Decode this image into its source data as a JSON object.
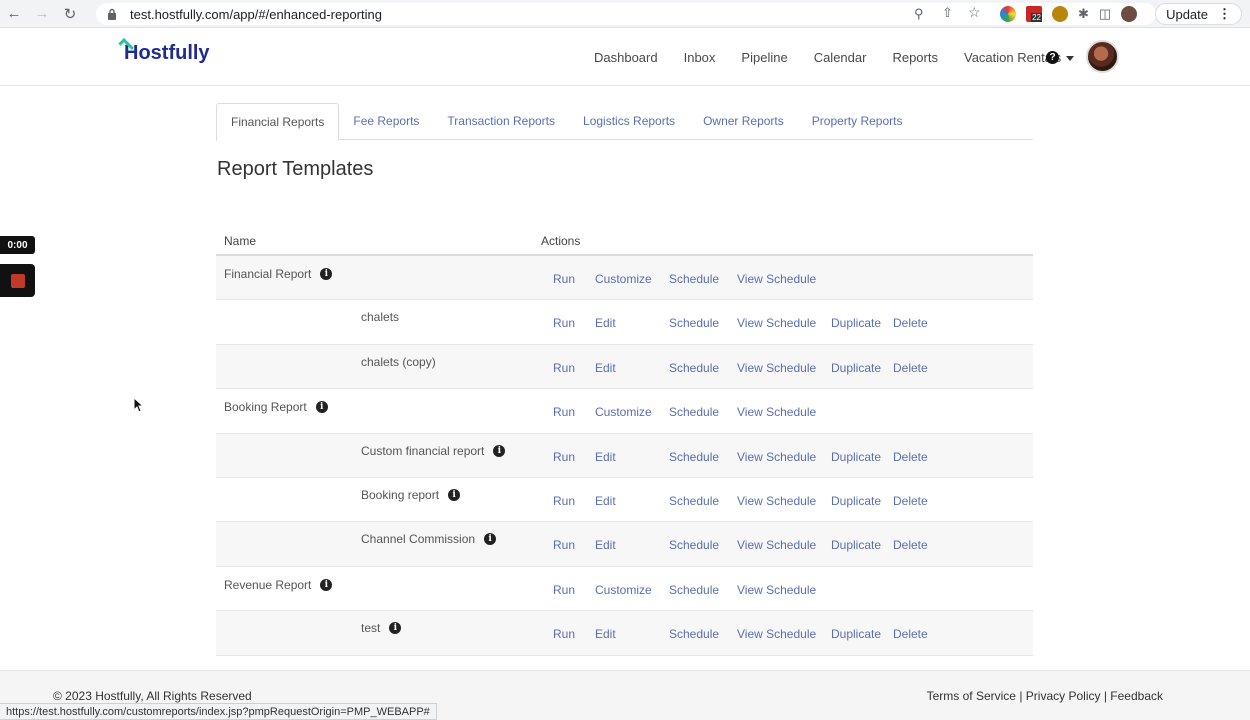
{
  "browser": {
    "url": "test.hostfully.com/app/#/enhanced-reporting",
    "update_label": "Update",
    "status_url": "https://test.hostfully.com/customreports/index.jsp?pmpRequestOrigin=PMP_WEBAPP#",
    "ext_badge": "22"
  },
  "header": {
    "logo_text": "Hostfully",
    "nav": [
      "Dashboard",
      "Inbox",
      "Pipeline",
      "Calendar",
      "Reports",
      "Vacation Rentals"
    ],
    "help_glyph": "?"
  },
  "tabs": [
    {
      "label": "Financial Reports",
      "active": true
    },
    {
      "label": "Fee Reports",
      "active": false
    },
    {
      "label": "Transaction Reports",
      "active": false
    },
    {
      "label": "Logistics Reports",
      "active": false
    },
    {
      "label": "Owner Reports",
      "active": false
    },
    {
      "label": "Property Reports",
      "active": false
    }
  ],
  "page": {
    "title": "Report Templates",
    "col_name": "Name",
    "col_actions": "Actions"
  },
  "actions": {
    "run": "Run",
    "customize": "Customize",
    "edit": "Edit",
    "schedule": "Schedule",
    "view_schedule": "View Schedule",
    "duplicate": "Duplicate",
    "delete": "Delete"
  },
  "rows": [
    {
      "name": "Financial Report",
      "type": "template",
      "info": true
    },
    {
      "name": "chalets",
      "type": "custom",
      "info": false
    },
    {
      "name": "chalets (copy)",
      "type": "custom",
      "info": false
    },
    {
      "name": "Booking Report",
      "type": "template",
      "info": true
    },
    {
      "name": "Custom financial report",
      "type": "custom",
      "info": true
    },
    {
      "name": "Booking report",
      "type": "custom",
      "info": true
    },
    {
      "name": "Channel Commission",
      "type": "custom",
      "info": true
    },
    {
      "name": "Revenue Report",
      "type": "template",
      "info": true
    },
    {
      "name": "test",
      "type": "custom",
      "info": true
    }
  ],
  "footer": {
    "copyright": "© 2023 Hostfully, All Rights Reserved",
    "terms": "Terms of Service",
    "privacy": "Privacy Policy",
    "feedback": "Feedback",
    "separator": "|"
  },
  "recorder": {
    "time": "0:00"
  },
  "colors": {
    "link": "#5a6fb0",
    "brand": "#1f2b8f",
    "brand_accent": "#28c3a6"
  }
}
